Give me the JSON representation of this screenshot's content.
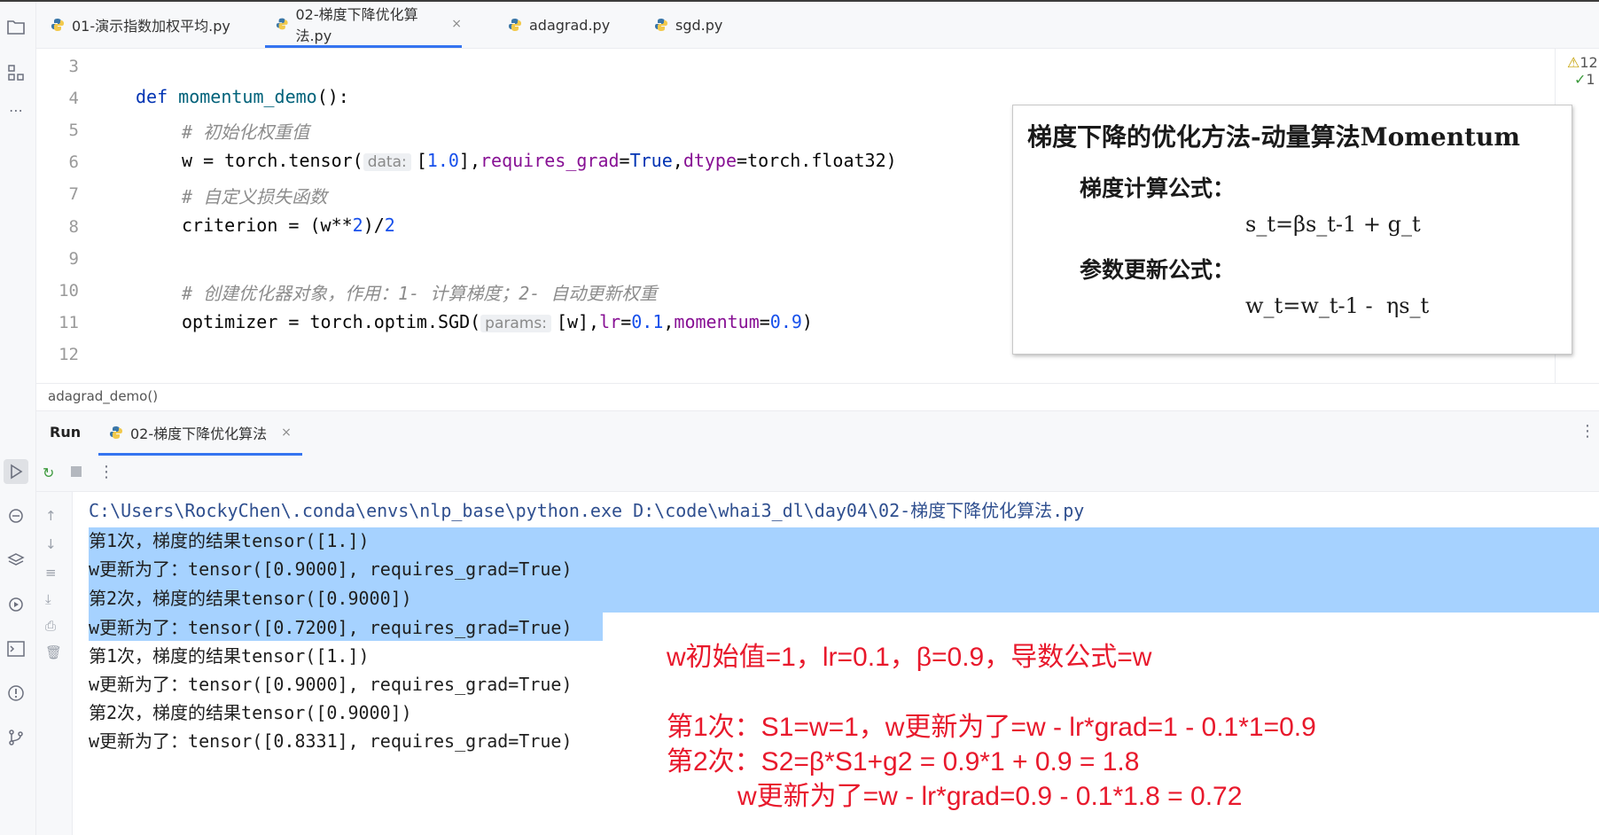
{
  "tabs": [
    {
      "label": "01-演示指数加权平均.py"
    },
    {
      "label": "02-梯度下降优化算法.py",
      "close": "×"
    },
    {
      "label": "adagrad.py"
    },
    {
      "label": "sgd.py"
    }
  ],
  "editor": {
    "line_numbers": [
      "3",
      "4",
      "5",
      "6",
      "7",
      "8",
      "9",
      "10",
      "11",
      "12"
    ],
    "code": {
      "l4_def": "def",
      "l4_name": "momentum_demo",
      "l4_rest": "():",
      "l5_comment": "# 初始化权重值",
      "l6_a": "w = torch.tensor(",
      "l6_hint": "data:",
      "l6_b": "[",
      "l6_num": "1.0",
      "l6_c": "],",
      "l6_k1": "requires_grad",
      "l6_eq1": "=",
      "l6_true": "True",
      "l6_comma": ",",
      "l6_k2": "dtype",
      "l6_d": "=torch.float32)",
      "l8_comment": "# 自定义损失函数",
      "l9_a": "criterion = (w**",
      "l9_n1": "2",
      "l9_b": ")/",
      "l9_n2": "2",
      "l11_comment": "# 创建优化器对象，作用：1- 计算梯度；2- 自动更新权重",
      "l12_a": "optimizer = torch.optim.SGD(",
      "l12_hint": "params:",
      "l12_b": "[w],",
      "l12_k1": "lr",
      "l12_eq1": "=",
      "l12_n1": "0.1",
      "l12_comma": ",",
      "l12_k2": "momentum",
      "l12_eq2": "=",
      "l12_n2": "0.9",
      "l12_c": ")"
    },
    "inspections": {
      "warnings": "12",
      "ok": "1"
    }
  },
  "overlay": {
    "title": "梯度下降的优化方法-动量算法Momentum",
    "grad_label": "梯度计算公式：",
    "grad_formula": "s_t=βs_t-1 + g_t",
    "update_label": "参数更新公式：",
    "update_formula": "w_t=w_t-1 -  ηs_t"
  },
  "breadcrumb": "adagrad_demo()",
  "run": {
    "label": "Run",
    "tab": "02-梯度下降优化算法",
    "tab_close": "×"
  },
  "console": {
    "lines": [
      "C:\\Users\\RockyChen\\.conda\\envs\\nlp_base\\python.exe D:\\code\\whai3_dl\\day04\\02-梯度下降优化算法.py",
      "第1次，梯度的结果tensor([1.])",
      "w更新为了：tensor([0.9000], requires_grad=True)",
      "第2次，梯度的结果tensor([0.9000])",
      "w更新为了：tensor([0.7200], requires_grad=True)",
      "第1次，梯度的结果tensor([1.])",
      "w更新为了：tensor([0.9000], requires_grad=True)",
      "第2次，梯度的结果tensor([0.9000])",
      "w更新为了：tensor([0.8331], requires_grad=True)"
    ]
  },
  "notes": {
    "n1": "w初始值=1，lr=0.1，β=0.9，导数公式=w",
    "n2": "第1次：S1=w=1，w更新为了=w - lr*grad=1 - 0.1*1=0.9",
    "n3": "第2次：S2=β*S1+g2 = 0.9*1 + 0.9 = 1.8",
    "n4": "w更新为了=w - lr*grad=0.9 - 0.1*1.8 = 0.72"
  },
  "colors": {
    "accent": "#3574f0",
    "annotation": "#e8192c",
    "selection": "#a6d2ff"
  }
}
